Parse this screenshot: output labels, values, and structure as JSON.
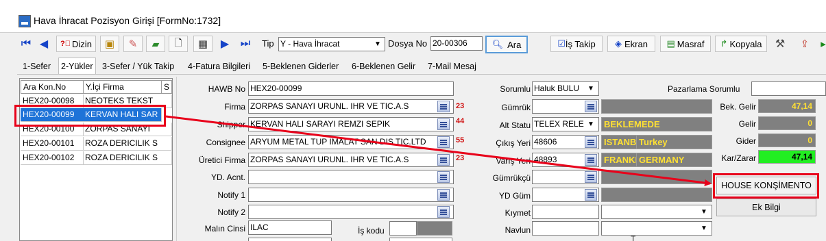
{
  "window": {
    "title": "Hava İhracat Pozisyon Girişi [FormNo:1732]"
  },
  "toolbar": {
    "dizin_label": "Dizin",
    "tip_label": "Tip",
    "tip_value": "Y - Hava İhracat",
    "dosya_label": "Dosya No",
    "dosya_value": "20-00306",
    "ara_label": "Ara",
    "is_takip_label": "İş Takip",
    "ekran_label": "Ekran",
    "masraf_label": "Masraf",
    "kopyala_label": "Kopyala"
  },
  "tabs": [
    "1-Sefer",
    "2-Yükler",
    "3-Sefer / Yük Takip",
    "4-Fatura Bilgileri",
    "5-Beklenen Giderler",
    "6-Beklenen Gelir",
    "7-Mail Mesaj"
  ],
  "grid": {
    "headers": [
      "Ara Kon.No",
      "Y.İçi Firma",
      "S"
    ],
    "rows": [
      {
        "kon": "HEX20-00098",
        "firma": "NEOTEKS TEKST"
      },
      {
        "kon": "HEX20-00099",
        "firma": "KERVAN HALI SAR"
      },
      {
        "kon": "HEX20-00100",
        "firma": "ZORPAS SANAYI"
      },
      {
        "kon": "HEX20-00101",
        "firma": "ROZA DERICILIK S"
      },
      {
        "kon": "HEX20-00102",
        "firma": "ROZA DERICILIK S"
      }
    ]
  },
  "form": {
    "hawb_label": "HAWB No",
    "hawb_value": "HEX20-00099",
    "firma_label": "Firma",
    "firma_value": "ZORPAS SANAYI URUNL. IHR VE TIC.A.S",
    "firma_num": "23",
    "shipper_label": "Shipper",
    "shipper_value": "KERVAN HALI SARAYI REMZI SEPIK",
    "shipper_num": "44",
    "consignee_label": "Consignee",
    "consignee_value": "ARYUM METAL TUP IMALAT SAN DIS TIC.LTD",
    "consignee_num": "55",
    "uretici_label": "Üretici Firma",
    "uretici_value": "ZORPAS SANAYI URUNL. IHR VE TIC.A.S",
    "uretici_num": "23",
    "ydacnt_label": "YD. Acnt.",
    "notify1_label": "Notify 1",
    "notify2_label": "Notify 2",
    "malin_label": "Malın Cinsi",
    "malin_value": "ILAC",
    "iskodu_label": "İş kodu"
  },
  "mid": {
    "sorumlu_label": "Sorumlu",
    "sorumlu_value": "Haluk BULU",
    "gumruk_label": "Gümrük",
    "altstatu_label": "Alt Statu",
    "altstatu_value": "TELEX RELE",
    "altstatu_display": "BEKLEMEDE",
    "cikis_label": "Çıkış Yeri",
    "cikis_code": "48606",
    "cikis_city": "ISTANBU",
    "cikis_country": "Turkey",
    "varis_label": "Varış Yeri",
    "varis_code": "48893",
    "varis_city": "FRANKF",
    "varis_country": "GERMANY",
    "gumrukcu_label": "Gümrükçü",
    "ydgum_label": "YD Güm",
    "kiymet_label": "Kıymet",
    "navlun_label": "Navlun"
  },
  "right": {
    "pazarlama_label": "Pazarlama Sorumlu",
    "bek_gelir_label": "Bek. Gelir",
    "bek_gelir_value": "47,14",
    "gelir_label": "Gelir",
    "gelir_value": "0",
    "gider_label": "Gider",
    "gider_value": "0",
    "karzarar_label": "Kar/Zarar",
    "karzarar_value": "47,14",
    "house_btn": "HOUSE KONŞİMENTO",
    "ek_btn": "Ek Bilgi"
  },
  "colors": {
    "accent_red": "#e8001a",
    "selection_blue": "#1e73d8",
    "profit_green": "#22ee22",
    "readonly_gray": "#808080",
    "value_yellow": "#ffe033"
  }
}
